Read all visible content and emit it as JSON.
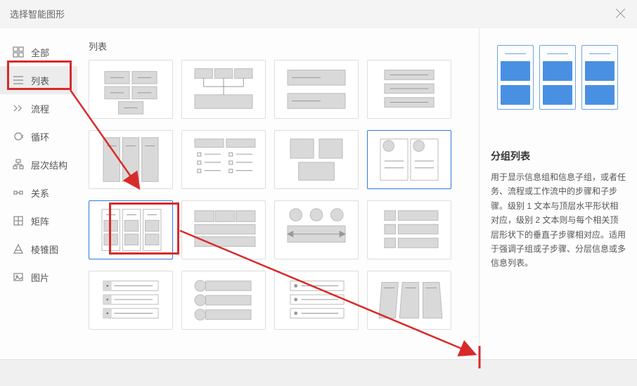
{
  "dialog": {
    "title": "选择智能图形"
  },
  "sidebar": {
    "items": [
      {
        "label": "全部"
      },
      {
        "label": "列表"
      },
      {
        "label": "流程"
      },
      {
        "label": "循环"
      },
      {
        "label": "层次结构"
      },
      {
        "label": "关系"
      },
      {
        "label": "矩阵"
      },
      {
        "label": "棱锥图"
      },
      {
        "label": "图片"
      }
    ]
  },
  "gallery": {
    "section_title": "列表"
  },
  "preview": {
    "title": "分组列表",
    "desc": "用于显示信息组和信息子组，或者任务、流程或工作流中的步骤和子步骤。级别 1 文本与顶层水平形状相对应，级别 2 文本则与每个相关顶层形状下的垂直子步骤相对应。适用于强调子组或子步骤、分层信息或多信息列表。"
  }
}
